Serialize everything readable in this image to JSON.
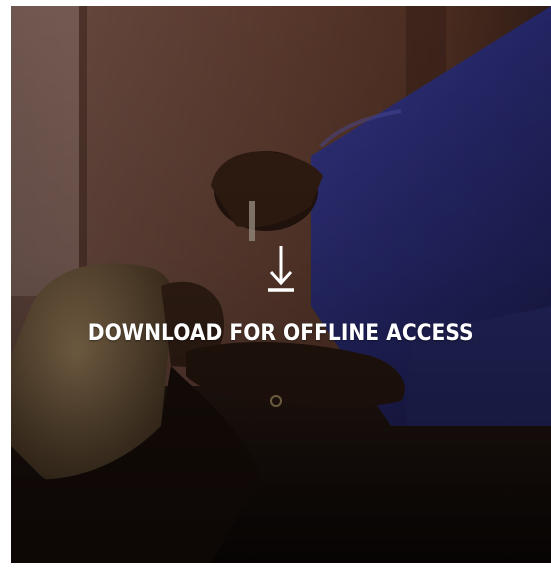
{
  "download_card": {
    "label": "DOWNLOAD FOR OFFLINE ACCESS",
    "icon": "download-arrow-icon",
    "text_color": "#ffffff"
  },
  "photo": {
    "subject": "background-photo"
  }
}
